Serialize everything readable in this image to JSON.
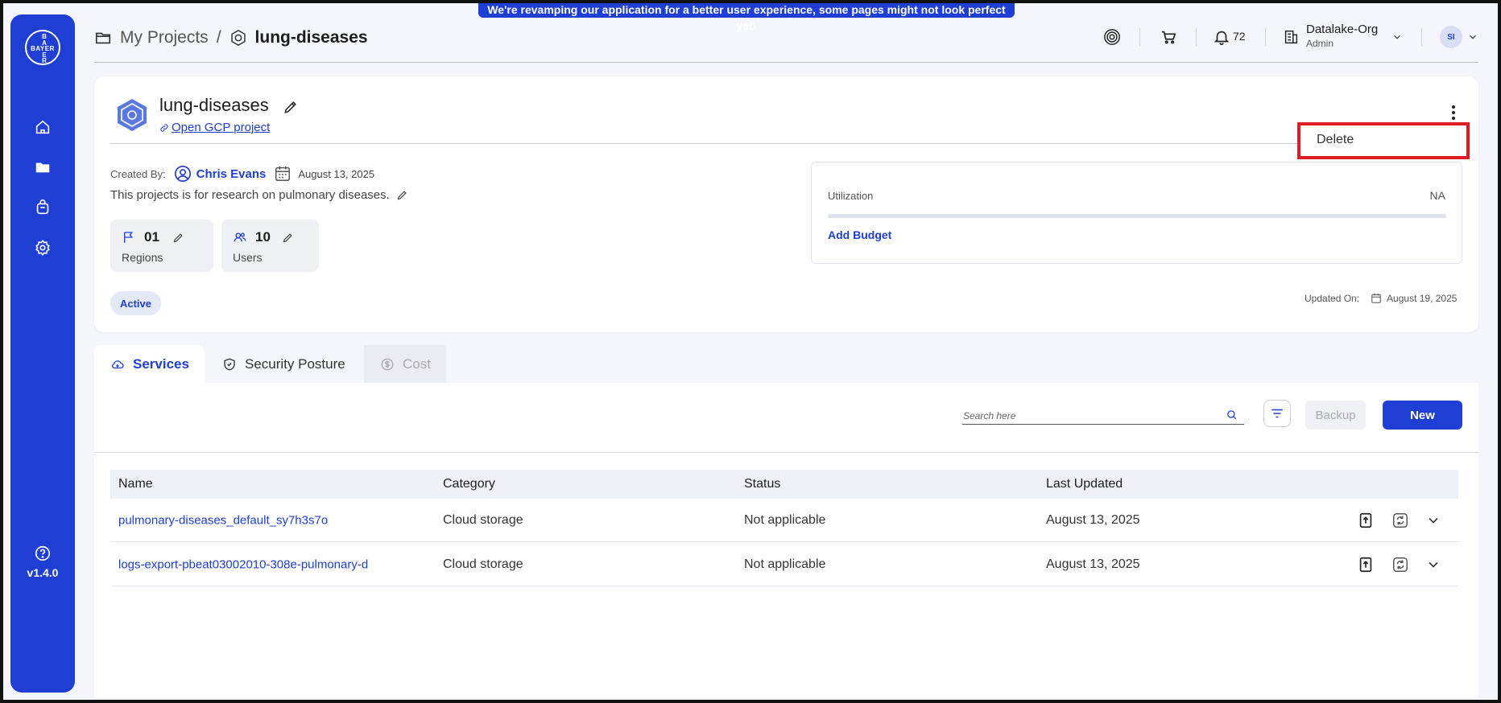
{
  "banner": "We're revamping our application for a better user experience, some pages might not look perfect yet!",
  "sidebar": {
    "logo_vertical": [
      "B",
      "A",
      "Y",
      "E",
      "R"
    ],
    "logo_horizontal": "BAYER",
    "items": [
      {
        "icon": "home-icon"
      },
      {
        "icon": "folder-icon"
      },
      {
        "icon": "bag-icon"
      },
      {
        "icon": "gear-icon"
      }
    ],
    "help_icon": "help-icon",
    "version": "v1.4.0"
  },
  "header": {
    "breadcrumb_root": "My Projects",
    "breadcrumb_sep": "/",
    "breadcrumb_current": "lung-diseases",
    "notifications_count": "72",
    "org_name": "Datalake-Org",
    "org_role": "Admin",
    "avatar_initials": "SI"
  },
  "project": {
    "title": "lung-diseases",
    "gcp_link": "Open GCP project",
    "menu_item": "Delete",
    "created_by_label": "Created By:",
    "creator": "Chris Evans",
    "created_date": "August 13, 2025",
    "description": "This projects is for research on pulmonary diseases.",
    "stats": [
      {
        "value": "01",
        "label": "Regions",
        "icon": "flag-icon"
      },
      {
        "value": "10",
        "label": "Users",
        "icon": "users-icon"
      }
    ],
    "status": "Active",
    "utilization_label": "Utilization",
    "utilization_value": "NA",
    "utilization_fraction": 0,
    "add_budget": "Add Budget",
    "updated_label": "Updated On:",
    "updated_date": "August 19, 2025"
  },
  "tabs": [
    {
      "label": "Services",
      "icon": "cloud-icon",
      "state": "active"
    },
    {
      "label": "Security Posture",
      "icon": "shield-icon",
      "state": "normal"
    },
    {
      "label": "Cost",
      "icon": "dollar-icon",
      "state": "disabled"
    }
  ],
  "toolbar": {
    "search_placeholder": "Search here",
    "backup_label": "Backup",
    "new_label": "New"
  },
  "table": {
    "columns": [
      "Name",
      "Category",
      "Status",
      "Last Updated"
    ],
    "rows": [
      {
        "name": "pulmonary-diseases_default_sy7h3s7o",
        "category": "Cloud storage",
        "status": "Not applicable",
        "updated": "August 13, 2025"
      },
      {
        "name": "logs-export-pbeat03002010-308e-pulmonary-d",
        "category": "Cloud storage",
        "status": "Not applicable",
        "updated": "August 13, 2025"
      }
    ]
  },
  "colors": {
    "brand": "#1f3fd4",
    "highlight": "#e01b24",
    "page_bg": "#f4f6fb"
  }
}
